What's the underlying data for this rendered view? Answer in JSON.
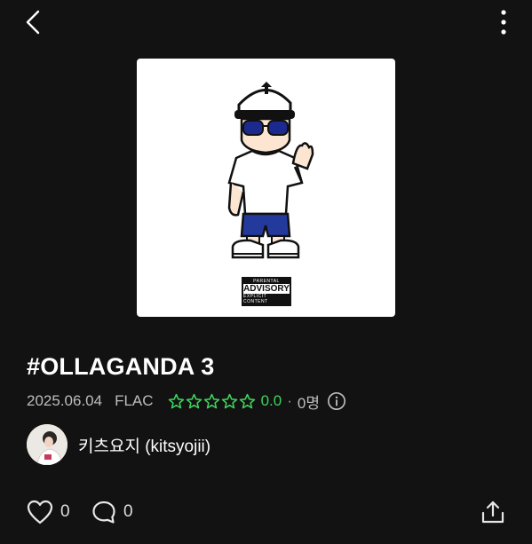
{
  "album": {
    "title": "#OLLAGANDA 3",
    "release_date": "2025.06.04",
    "format": "FLAC",
    "rating_value": "0.0",
    "rating_separator": "·",
    "rating_count": "0명",
    "rating_stars_filled": 0,
    "rating_stars_total": 5
  },
  "cover": {
    "advisory_line1": "PARENTAL",
    "advisory_line2": "ADVISORY",
    "advisory_line3": "EXPLICIT CONTENT"
  },
  "artist": {
    "name": "키츠요지 (kitsyojii)"
  },
  "actions": {
    "like_count": "0",
    "comment_count": "0"
  },
  "icons": {
    "back": "back-arrow-icon",
    "more": "more-vertical-icon",
    "star": "star-outline-icon",
    "info": "info-icon",
    "heart": "heart-icon",
    "comment": "comment-bubble-icon",
    "share": "share-icon"
  },
  "colors": {
    "background": "#121212",
    "rating_green": "#3fd25d",
    "text_secondary": "#bdbdbd"
  }
}
